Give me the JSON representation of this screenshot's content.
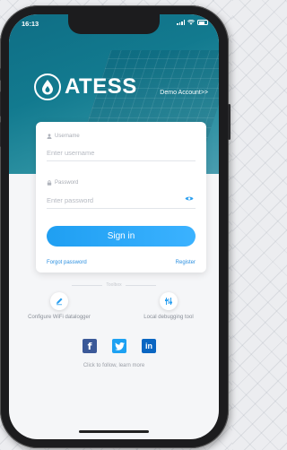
{
  "status_bar": {
    "time": "16:13"
  },
  "brand": {
    "name": "ATESS"
  },
  "header": {
    "demo_account_label": "Demo Account>>"
  },
  "login_form": {
    "username_label": "Username",
    "username_placeholder": "Enter username",
    "password_label": "Password",
    "password_placeholder": "Enter password",
    "sign_in_label": "Sign in",
    "forgot_password_label": "Forgot password",
    "register_label": "Register"
  },
  "tools": {
    "divider_label": "Toolbox",
    "configure_wifi_label": "Configure WiFi datalogger",
    "local_debugging_label": "Local debugging tool"
  },
  "social": {
    "icons": [
      "facebook-icon",
      "twitter-icon",
      "linkedin-icon"
    ],
    "follow_text": "Click to follow, learn more"
  },
  "colors": {
    "primary": "#2a9ff0",
    "hero_teal": "#127a8f",
    "facebook": "#3b5998",
    "twitter": "#1da1f2",
    "linkedin": "#0a66c2"
  }
}
